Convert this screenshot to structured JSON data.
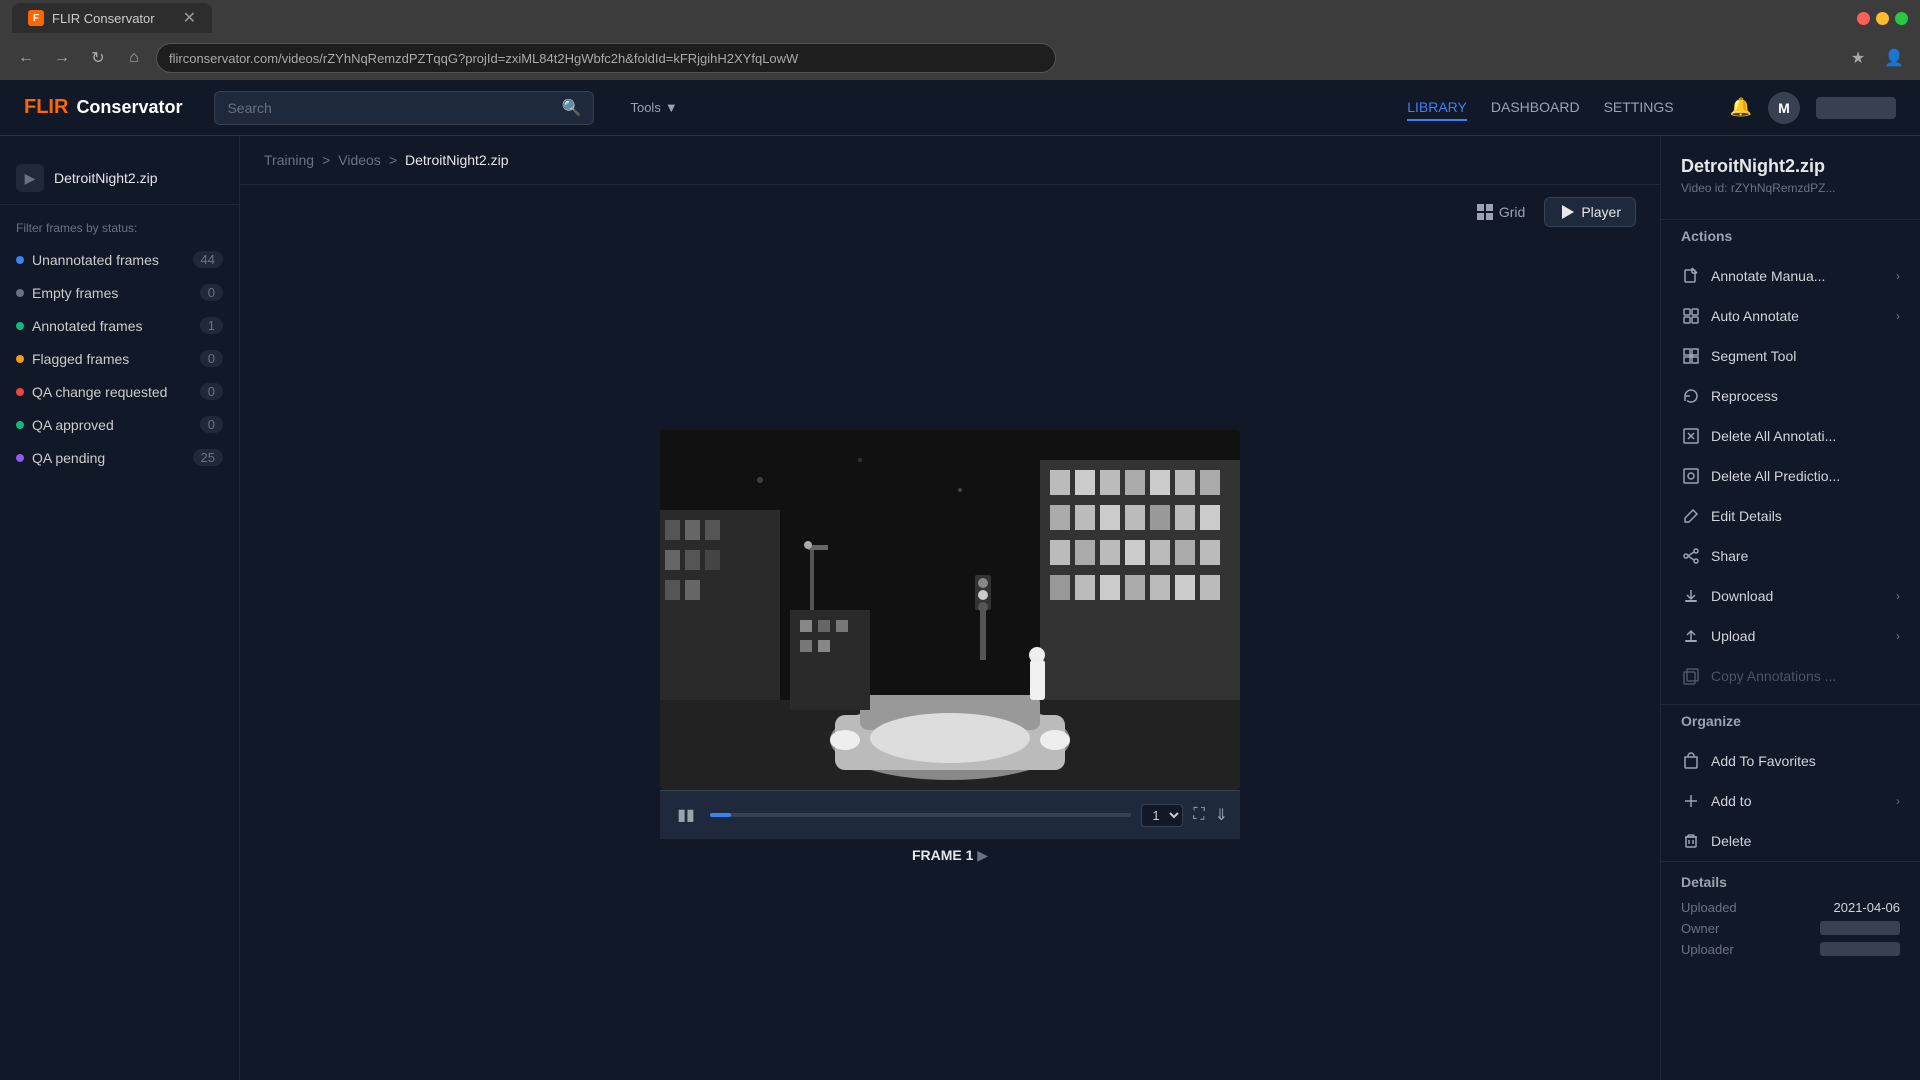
{
  "browser": {
    "tab_title": "FLIR Conservator",
    "url": "flirconservator.com/videos/rZYhNqRemzdPZTqqG?projId=zxiML84t2HgWbfc2h&foldId=kFRjgihH2XYfqLowW",
    "favicon_text": "F"
  },
  "topnav": {
    "logo_flir": "FLIR",
    "logo_app": "Conservator",
    "search_placeholder": "Search",
    "tools_label": "Tools",
    "nav_links": [
      {
        "id": "library",
        "label": "LIBRARY",
        "active": true
      },
      {
        "id": "dashboard",
        "label": "DASHBOARD",
        "active": false
      },
      {
        "id": "settings",
        "label": "SETTINGS",
        "active": false
      }
    ],
    "avatar_letter": "M"
  },
  "sidebar": {
    "video_name": "DetroitNight2.zip",
    "filter_label": "Filter frames by status:",
    "filters": [
      {
        "id": "unannotated",
        "label": "Unannotated frames",
        "count": 44,
        "dot_color": "blue"
      },
      {
        "id": "empty",
        "label": "Empty frames",
        "count": 0,
        "dot_color": "gray"
      },
      {
        "id": "annotated",
        "label": "Annotated frames",
        "count": 1,
        "dot_color": "green"
      },
      {
        "id": "flagged",
        "label": "Flagged frames",
        "count": 0,
        "dot_color": "yellow"
      },
      {
        "id": "qa_change",
        "label": "QA change requested",
        "count": 0,
        "dot_color": "red"
      },
      {
        "id": "qa_approved",
        "label": "QA approved",
        "count": 0,
        "dot_color": "green"
      },
      {
        "id": "qa_pending",
        "label": "QA pending",
        "count": 25,
        "dot_color": "purple"
      }
    ]
  },
  "breadcrumb": {
    "items": [
      {
        "label": "Training",
        "link": true
      },
      {
        "label": "Videos",
        "link": true
      },
      {
        "label": "DetroitNight2.zip",
        "link": false
      }
    ],
    "separator": ">"
  },
  "view_controls": {
    "grid_label": "Grid",
    "player_label": "Player"
  },
  "video_player": {
    "frame_label": "FRAME 1",
    "frame_number": "1",
    "progress_percent": 5
  },
  "right_panel": {
    "title": "DetroitNight2.zip",
    "video_id_label": "Video id: rZYhNqRemzdPZ...",
    "actions_title": "Actions",
    "actions": [
      {
        "id": "annotate",
        "label": "Annotate Manua...",
        "icon": "✎",
        "has_arrow": true,
        "disabled": false
      },
      {
        "id": "auto_annotate",
        "label": "Auto Annotate",
        "icon": "⟳",
        "has_arrow": true,
        "disabled": false
      },
      {
        "id": "segment_tool",
        "label": "Segment Tool",
        "icon": "⊞",
        "has_arrow": false,
        "disabled": false
      },
      {
        "id": "reprocess",
        "label": "Reprocess",
        "icon": "↺",
        "has_arrow": false,
        "disabled": false
      },
      {
        "id": "delete_annotations",
        "label": "Delete All Annotati...",
        "icon": "⊠",
        "has_arrow": false,
        "disabled": false
      },
      {
        "id": "delete_predictions",
        "label": "Delete All Predictio...",
        "icon": "⊡",
        "has_arrow": false,
        "disabled": false
      },
      {
        "id": "edit_details",
        "label": "Edit Details",
        "icon": "✎",
        "has_arrow": false,
        "disabled": false
      },
      {
        "id": "share",
        "label": "Share",
        "icon": "♟",
        "has_arrow": false,
        "disabled": false
      },
      {
        "id": "download",
        "label": "Download",
        "icon": "↓",
        "has_arrow": true,
        "disabled": false
      },
      {
        "id": "upload",
        "label": "Upload",
        "icon": "↑",
        "has_arrow": true,
        "disabled": false
      },
      {
        "id": "copy_annotations",
        "label": "Copy Annotations ...",
        "icon": "⧉",
        "has_arrow": false,
        "disabled": true
      }
    ],
    "organize_title": "Organize",
    "organize_actions": [
      {
        "id": "add_favorites",
        "label": "Add To Favorites",
        "icon": "♡",
        "has_arrow": false
      },
      {
        "id": "add_to",
        "label": "Add to",
        "icon": "+",
        "has_arrow": true
      },
      {
        "id": "delete",
        "label": "Delete",
        "icon": "🗑",
        "has_arrow": false
      }
    ],
    "details_title": "Details",
    "details": [
      {
        "key": "Uploaded",
        "value": "2021-04-06"
      },
      {
        "key": "Owner",
        "value": ""
      },
      {
        "key": "Uploader",
        "value": ""
      }
    ]
  }
}
